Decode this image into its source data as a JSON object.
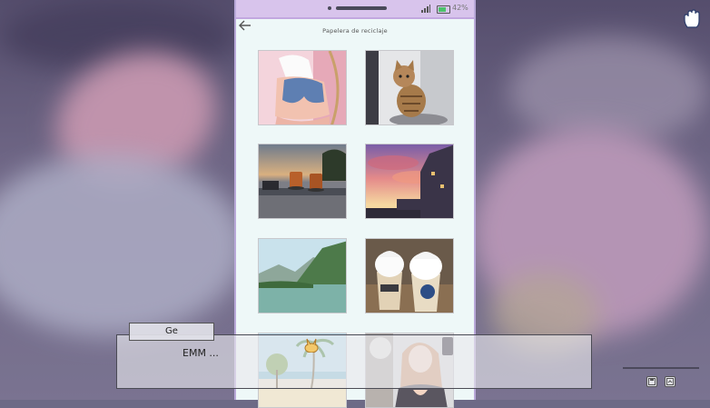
{
  "status_bar": {
    "battery_text": "42%"
  },
  "app": {
    "title": "Papelera de reciclaje"
  },
  "gallery": {
    "items": [
      {
        "name": "photo-girl-shorts"
      },
      {
        "name": "photo-tabby-cat"
      },
      {
        "name": "photo-drinks-sunset"
      },
      {
        "name": "photo-city-sky"
      },
      {
        "name": "photo-lake-mountains"
      },
      {
        "name": "photo-iced-coffees"
      },
      {
        "name": "photo-beach-palms"
      },
      {
        "name": "photo-girl-portrait"
      }
    ]
  },
  "dialogue": {
    "speaker": "Ge",
    "text": "EMM ..."
  },
  "icons": {
    "cursor": "hand-cursor-icon",
    "back": "back-arrow-icon",
    "quick_1": "save-icon",
    "quick_2": "load-icon"
  }
}
